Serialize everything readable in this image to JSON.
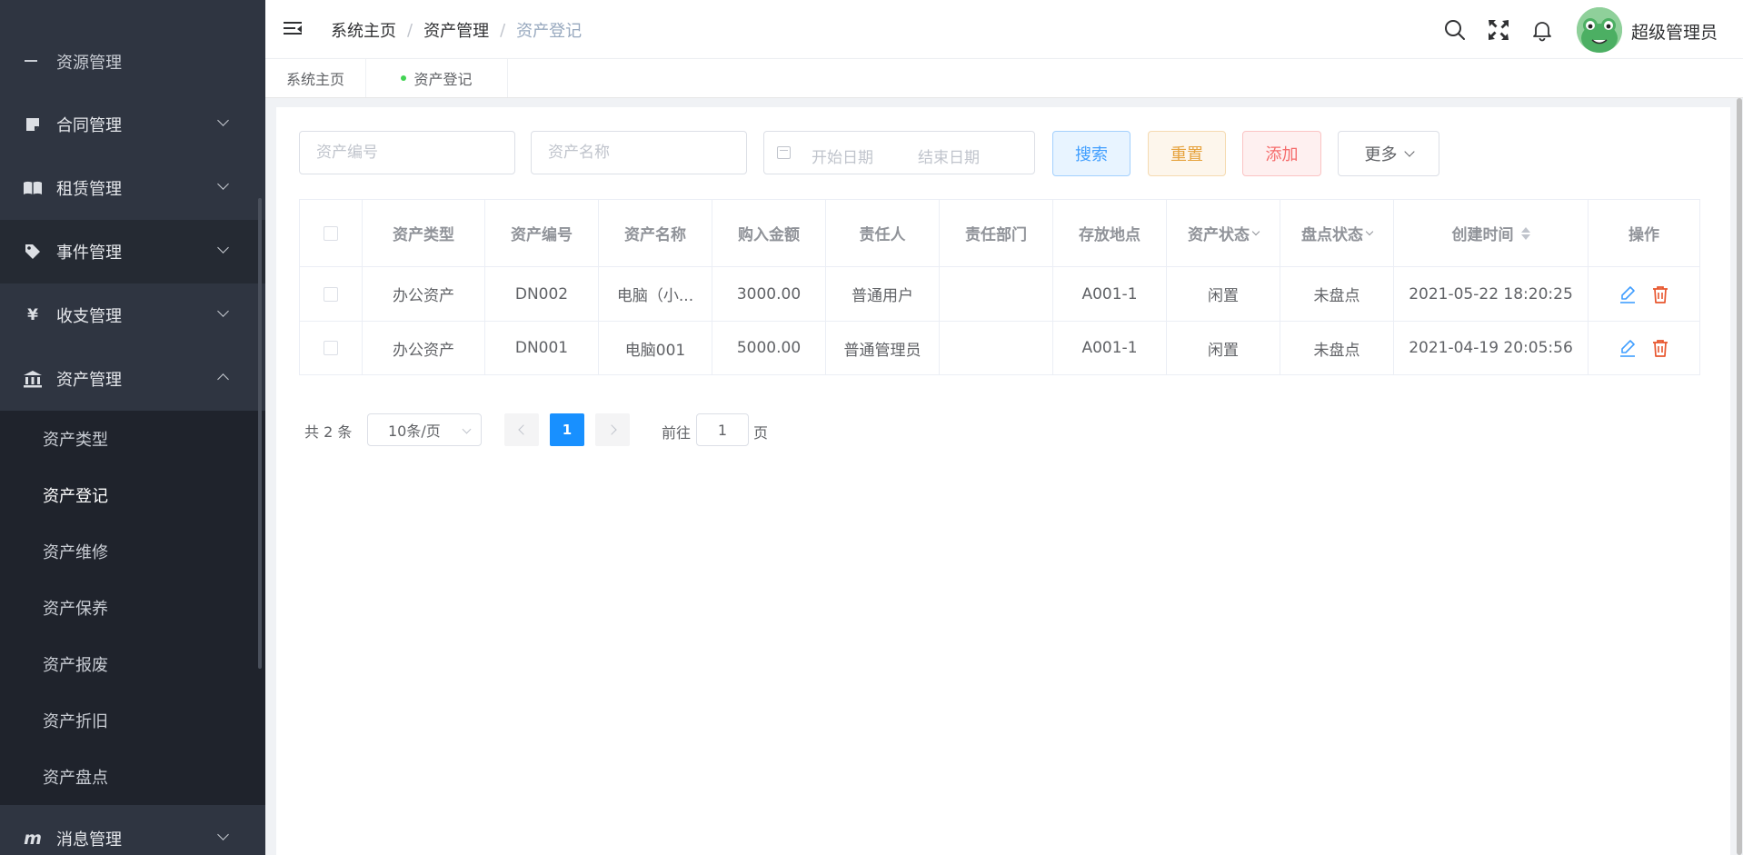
{
  "sidebar": {
    "partial_item": "资源管理",
    "menus": [
      {
        "label": "合同管理",
        "icon": "note-icon"
      },
      {
        "label": "租赁管理",
        "icon": "book-icon"
      },
      {
        "label": "事件管理",
        "icon": "tag-icon"
      },
      {
        "label": "收支管理",
        "icon": "yen-icon"
      },
      {
        "label": "资产管理",
        "icon": "bank-icon"
      },
      {
        "label": "消息管理",
        "icon": "message-m-icon"
      }
    ],
    "yen_glyph": "¥",
    "m_glyph": "m",
    "submenu": [
      "资产类型",
      "资产登记",
      "资产维修",
      "资产保养",
      "资产报废",
      "资产折旧",
      "资产盘点"
    ],
    "active_submenu": "资产登记"
  },
  "header": {
    "breadcrumb": [
      "系统主页",
      "资产管理",
      "资产登记"
    ],
    "separator": "/",
    "username": "超级管理员"
  },
  "tags": [
    {
      "label": "系统主页",
      "active": false
    },
    {
      "label": "资产登记",
      "active": true
    }
  ],
  "search": {
    "asset_no_placeholder": "资产编号",
    "asset_name_placeholder": "资产名称",
    "start_date_placeholder": "开始日期",
    "end_date_placeholder": "结束日期",
    "search_label": "搜索",
    "reset_label": "重置",
    "add_label": "添加",
    "more_label": "更多"
  },
  "table": {
    "headers": [
      "资产类型",
      "资产编号",
      "资产名称",
      "购入金额",
      "责任人",
      "责任部门",
      "存放地点",
      "资产状态",
      "盘点状态",
      "创建时间",
      "操作"
    ],
    "rows": [
      [
        "办公资产",
        "DN002",
        "电脑（小...",
        "3000.00",
        "普通用户",
        "",
        "A001-1",
        "闲置",
        "未盘点",
        "2021-05-22 18:20:25"
      ],
      [
        "办公资产",
        "DN001",
        "电脑001",
        "5000.00",
        "普通管理员",
        "",
        "A001-1",
        "闲置",
        "未盘点",
        "2021-04-19 20:05:56"
      ]
    ]
  },
  "pagination": {
    "total_text": "共 2 条",
    "page_size": "10条/页",
    "current_page": "1",
    "goto_label": "前往",
    "goto_value": "1",
    "page_suffix": "页"
  },
  "colors": {
    "sidebar_bg": "#2f3541",
    "primary": "#1890ff",
    "warning": "#e6a23c",
    "danger": "#f56c6c",
    "edit_icon": "#409eff",
    "delete_icon": "#e8552d",
    "active_tag_dot": "#42d353"
  }
}
